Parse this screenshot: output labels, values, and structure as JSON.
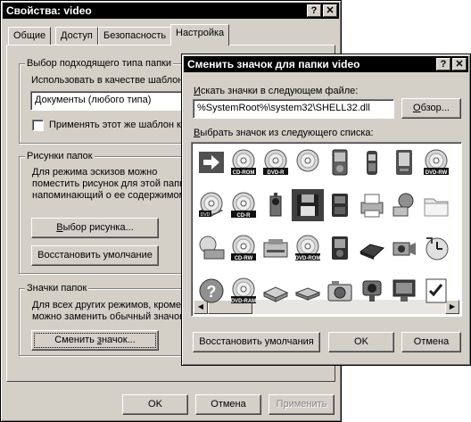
{
  "props": {
    "title": "Свойства: video",
    "tabs": [
      "Общие",
      "Доступ",
      "Безопасность",
      "Настройка"
    ],
    "group1": {
      "label": "Выбор подходящего типа папки",
      "use_as_label": "Использовать в качестве шаблона:",
      "template_value": "Документы (любого типа)",
      "apply_checkbox": "Применять этот же шаблон ко всем вложенным папкам"
    },
    "group2": {
      "label": "Рисунки папок",
      "desc_lines": [
        "Для режима эскизов можно",
        "поместить рисунок для этой папки,",
        "напоминающий о ее содержимом."
      ],
      "choose_button": "Выбор рисунка...",
      "restore_button": "Восстановить умолчание"
    },
    "group3": {
      "label": "Значки папок",
      "desc_lines": [
        "Для всех других режимов, кроме эскизов,",
        "можно заменить обычный значок папки."
      ],
      "change_button": "Сменить значок..."
    },
    "ok": "OK",
    "cancel": "Отмена",
    "apply": "Применить"
  },
  "change_icon": {
    "title": "Сменить значок для папки video",
    "search_label": "Искать значки в следующем файле:",
    "file_value": "%SystemRoot%\\system32\\SHELL32.dll",
    "browse_button": "Обзор...",
    "list_label": "Выбрать значок из следующего списка:",
    "restore_button": "Восстановить умолчания",
    "ok": "OK",
    "cancel": "Отмена",
    "icons": [
      "arrow-shortcut-icon",
      "cd-rom-icon",
      "dvd-r-icon",
      "cd-disc-icon",
      "mp3-player-icon",
      "cell-phone-icon",
      "pda-icon",
      "dvd-rw-icon",
      "dvd-drive-icon",
      "cd-r-icon",
      "camcorder-icon",
      "floppy-disk-icon",
      "memory-card-icon",
      "printer-icon",
      "network-globe-icon",
      "folder-icon",
      "cd-drive-icon",
      "cd-rw-icon",
      "tape-drive-icon",
      "dvd-rom-icon",
      "media-player-icon",
      "removable-drive-icon",
      "video-camera-icon",
      "clock-icon",
      "help-icon",
      "dvd-ram-icon",
      "zip-drive-icon",
      "hard-drive-icon",
      "digital-camera-icon",
      "webcam-icon",
      "display-icon",
      "checklist-icon"
    ],
    "disc_labels": {
      "cd-rom-icon": "CD-ROM",
      "dvd-r-icon": "DVD-R",
      "dvd-rw-icon": "DVD-RW",
      "cd-r-icon": "CD-R",
      "cd-rw-icon": "CD-RW",
      "dvd-rom-icon": "DVD-ROM",
      "dvd-ram-icon": "DVD-RAM",
      "dvd-drive-icon": "DVD"
    },
    "selected_index": 11
  }
}
